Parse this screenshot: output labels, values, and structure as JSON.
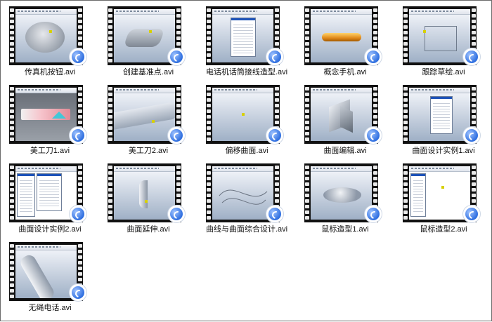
{
  "files": [
    {
      "name": "传真机按钮.avi"
    },
    {
      "name": "创建基准点.avi"
    },
    {
      "name": "电话机话筒接线造型.avi"
    },
    {
      "name": "概念手机.avi"
    },
    {
      "name": "跟踪草绘.avi"
    },
    {
      "name": "美工刀1.avi"
    },
    {
      "name": "美工刀2.avi"
    },
    {
      "name": "偏移曲面.avi"
    },
    {
      "name": "曲面编辑.avi"
    },
    {
      "name": "曲面设计实例1.avi"
    },
    {
      "name": "曲面设计实例2.avi"
    },
    {
      "name": "曲面延伸.avi"
    },
    {
      "name": "曲线与曲面综合设计.avi"
    },
    {
      "name": "鼠标造型1.avi"
    },
    {
      "name": "鼠标造型2.avi"
    },
    {
      "name": "无绳电话.avi"
    }
  ],
  "icons": {
    "file_badge": "media-player-badge-icon",
    "thumbnail": "video-film-strip-icon"
  },
  "colors": {
    "badge_blue": "#2f6fe0",
    "film_black": "#111111"
  }
}
